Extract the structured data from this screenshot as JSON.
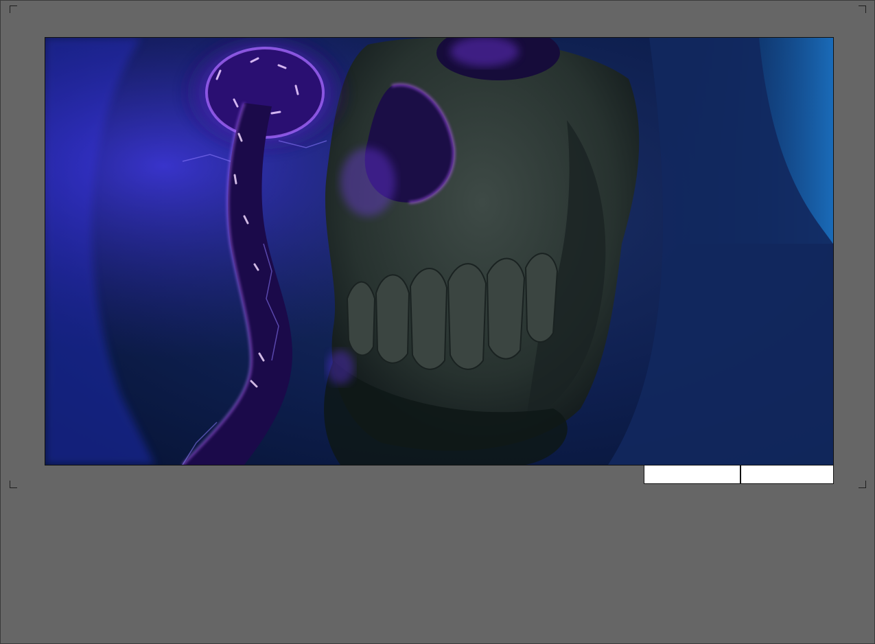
{
  "colors": {
    "page_background": "#666666",
    "frame_border": "#111111",
    "caption_background": "#ffffff",
    "glow_purple": "#7b3cff",
    "skull_tone": "#2f3a3a",
    "hood_blue": "#13306a"
  },
  "icons": [
    "crop-mark-icon"
  ],
  "image": {
    "subject": "skull-with-purple-energy"
  },
  "caption": {
    "left": "",
    "right": ""
  }
}
